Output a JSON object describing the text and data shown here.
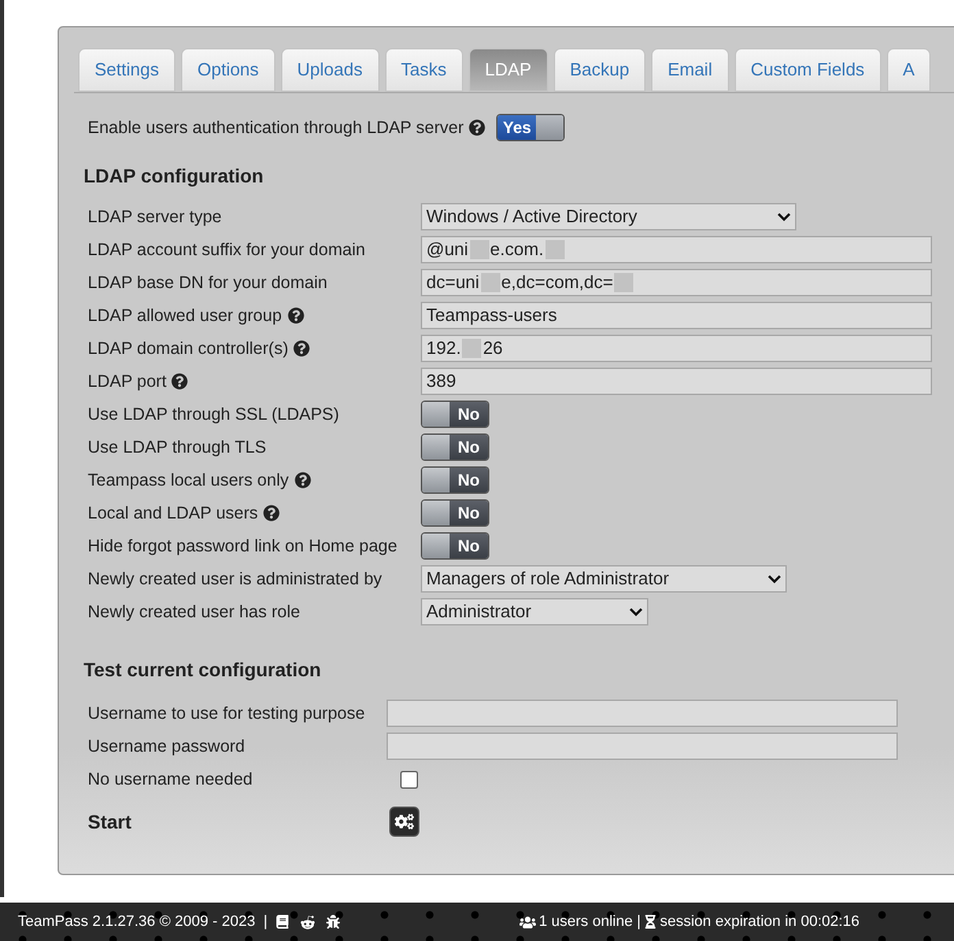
{
  "tabs": [
    {
      "label": "Settings",
      "selected": false
    },
    {
      "label": "Options",
      "selected": false
    },
    {
      "label": "Uploads",
      "selected": false
    },
    {
      "label": "Tasks",
      "selected": false
    },
    {
      "label": "LDAP",
      "selected": true
    },
    {
      "label": "Backup",
      "selected": false
    },
    {
      "label": "Email",
      "selected": false
    },
    {
      "label": "Custom Fields",
      "selected": false
    },
    {
      "label": "A",
      "selected": false
    }
  ],
  "enable": {
    "label": "Enable users authentication through LDAP server",
    "help": true,
    "toggle": {
      "text": "Yes",
      "on": true
    }
  },
  "ldap_configuration": {
    "title": "LDAP configuration",
    "rows": [
      {
        "kind": "select",
        "label": "LDAP server type",
        "help": false,
        "value": [
          {
            "kind": "text",
            "text": "Windows / Active Directory"
          }
        ]
      },
      {
        "kind": "input",
        "label": "LDAP account suffix for your domain",
        "help": false,
        "value": [
          {
            "kind": "text",
            "text": "@uni"
          },
          {
            "kind": "redacted"
          },
          {
            "kind": "text",
            "text": "e.com."
          },
          {
            "kind": "redacted"
          }
        ]
      },
      {
        "kind": "input",
        "label": "LDAP base DN for your domain",
        "help": false,
        "value": [
          {
            "kind": "text",
            "text": "dc=uni"
          },
          {
            "kind": "redacted"
          },
          {
            "kind": "text",
            "text": "e,dc=com,dc="
          },
          {
            "kind": "redacted"
          }
        ]
      },
      {
        "kind": "input",
        "label": "LDAP allowed user group",
        "help": true,
        "value": [
          {
            "kind": "text",
            "text": "Teampass-users"
          }
        ]
      },
      {
        "kind": "input",
        "label": "LDAP domain controller(s)",
        "help": true,
        "value": [
          {
            "kind": "text",
            "text": "192."
          },
          {
            "kind": "redacted"
          },
          {
            "kind": "text",
            "text": "26"
          }
        ]
      },
      {
        "kind": "input",
        "label": "LDAP port",
        "help": true,
        "value": [
          {
            "kind": "text",
            "text": "389"
          }
        ]
      },
      {
        "kind": "toggle",
        "label": "Use LDAP through SSL (LDAPS)",
        "help": false,
        "toggle": {
          "text": "No",
          "on": false
        }
      },
      {
        "kind": "toggle",
        "label": "Use LDAP through TLS",
        "help": false,
        "toggle": {
          "text": "No",
          "on": false
        }
      },
      {
        "kind": "toggle",
        "label": "Teampass local users only",
        "help": true,
        "toggle": {
          "text": "No",
          "on": false
        }
      },
      {
        "kind": "toggle",
        "label": "Local and LDAP users",
        "help": true,
        "toggle": {
          "text": "No",
          "on": false
        }
      },
      {
        "kind": "toggle",
        "label": "Hide forgot password link on Home page",
        "help": false,
        "toggle": {
          "text": "No",
          "on": false
        }
      },
      {
        "kind": "select",
        "label": "Newly created user is administrated by",
        "help": false,
        "value": [
          {
            "kind": "text",
            "text": "Managers of role Administrator"
          }
        ]
      },
      {
        "kind": "select",
        "label": "Newly created user has role",
        "help": false,
        "value": [
          {
            "kind": "text",
            "text": "Administrator"
          }
        ]
      }
    ]
  },
  "test": {
    "title": "Test current configuration",
    "rows": [
      {
        "kind": "input",
        "label": "Username to use for testing purpose"
      },
      {
        "kind": "input",
        "label": "Username password"
      },
      {
        "kind": "checkbox",
        "label": "No username needed",
        "checked": false
      }
    ],
    "start": {
      "label": "Start"
    }
  },
  "footer": {
    "version": "TeamPass 2.1.27.36 © 2009 - 2023",
    "separator": "|",
    "users": "1 users online |",
    "session": "session expiration in 00:02:16"
  }
}
